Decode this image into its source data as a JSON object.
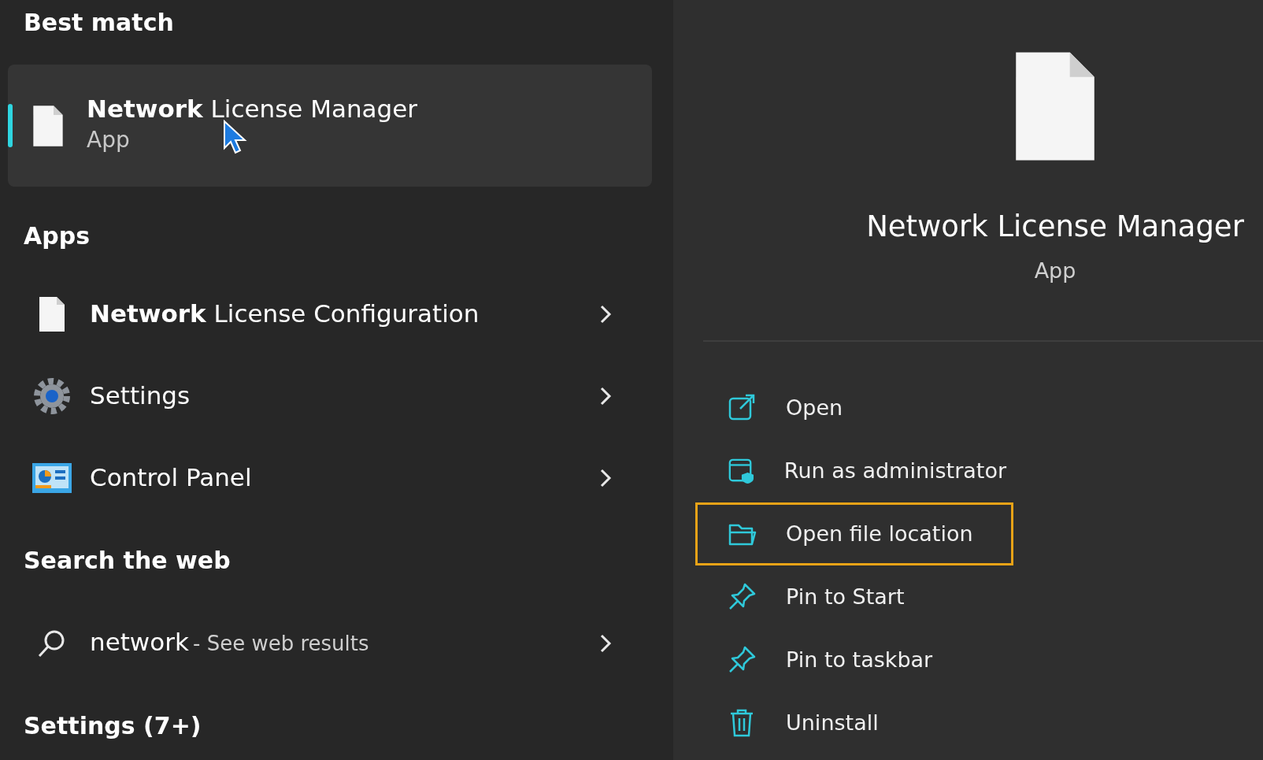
{
  "best_match": {
    "heading": "Best match",
    "item": {
      "title": "**Network** License Manager",
      "subtitle": "App",
      "selected": true
    }
  },
  "apps": {
    "heading": "Apps",
    "items": [
      {
        "kind": "file",
        "title": "**Network** License Configuration",
        "selected": false
      },
      {
        "kind": "gear",
        "title": "Settings",
        "selected": false
      },
      {
        "kind": "control-panel",
        "title": "Control Panel",
        "selected": false
      }
    ]
  },
  "web": {
    "heading": "Search the web",
    "query": "network",
    "suffix": "- See web results"
  },
  "more": {
    "heading": "Settings (7+)"
  },
  "details": {
    "title": "Network License Manager",
    "subtitle": "App",
    "actions": [
      {
        "kind": "open",
        "label": "Open",
        "highlighted": false
      },
      {
        "kind": "admin",
        "label": "Run as administrator",
        "highlighted": false
      },
      {
        "kind": "folder",
        "label": "Open file location",
        "highlighted": true
      },
      {
        "kind": "pin",
        "label": "Pin to Start",
        "highlighted": false
      },
      {
        "kind": "pin",
        "label": "Pin to taskbar",
        "highlighted": false
      },
      {
        "kind": "trash",
        "label": "Uninstall",
        "highlighted": false
      }
    ]
  }
}
